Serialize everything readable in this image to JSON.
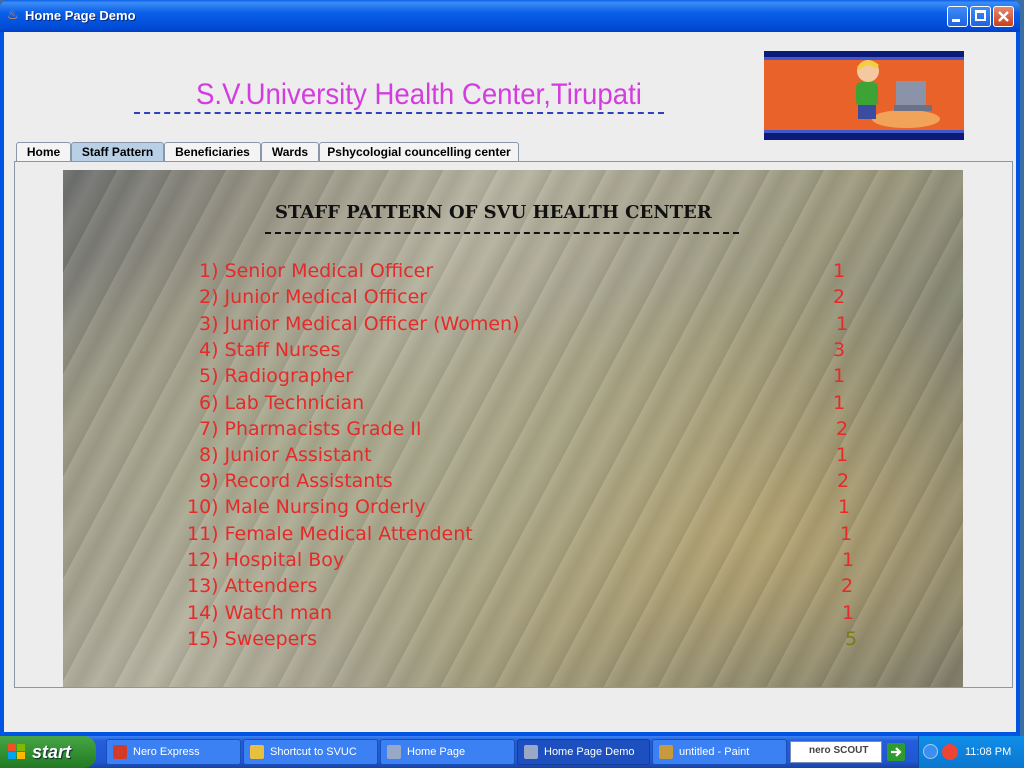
{
  "window": {
    "title": "Home Page Demo"
  },
  "header": {
    "heading": "S.V.University Health Center,Tirupati"
  },
  "tabs": [
    {
      "label": "Home"
    },
    {
      "label": "Staff Pattern",
      "active": true
    },
    {
      "label": "Beneficiaries"
    },
    {
      "label": "Wards"
    },
    {
      "label": "Pshycologial councelling center"
    }
  ],
  "staff": {
    "title": "STAFF PATTERN OF SVU HEALTH CENTER",
    "rows": [
      {
        "label": "1) Senior Medical Officer",
        "count": "1"
      },
      {
        "label": "2) Junior Medical Officer",
        "count": "2"
      },
      {
        "label": "3) Junior Medical Officer (Women)",
        "count": "1"
      },
      {
        "label": "4) Staff  Nurses",
        "count": "3"
      },
      {
        "label": "5) Radiographer",
        "count": "1"
      },
      {
        "label": "6) Lab Technician",
        "count": "1"
      },
      {
        "label": "7) Pharmacists  Grade II",
        "count": "2"
      },
      {
        "label": "8) Junior Assistant",
        "count": "1"
      },
      {
        "label": "9) Record Assistants",
        "count": "2"
      },
      {
        "label": "10) Male Nursing Orderly",
        "count": "1"
      },
      {
        "label": "11) Female Medical Attendent",
        "count": "1"
      },
      {
        "label": "12) Hospital Boy",
        "count": "1"
      },
      {
        "label": "13) Attenders",
        "count": "2"
      },
      {
        "label": "14) Watch man",
        "count": "1"
      },
      {
        "label": "15) Sweepers",
        "count": "5"
      }
    ],
    "colors": {
      "text": "#e52a2a",
      "last_count": "#7a7a1a"
    }
  },
  "taskbar": {
    "start_label": "start",
    "tasks": [
      {
        "label": "Nero Express",
        "icon": "nero-icon"
      },
      {
        "label": "Shortcut to SVUC",
        "icon": "shortcut-icon"
      },
      {
        "label": "Home Page",
        "icon": "java-icon"
      },
      {
        "label": "Home Page Demo",
        "icon": "java-icon",
        "active": true
      },
      {
        "label": "untitled - Paint",
        "icon": "paint-icon"
      }
    ],
    "nero_scout": "nero SCOUT",
    "clock": "11:08 PM"
  }
}
